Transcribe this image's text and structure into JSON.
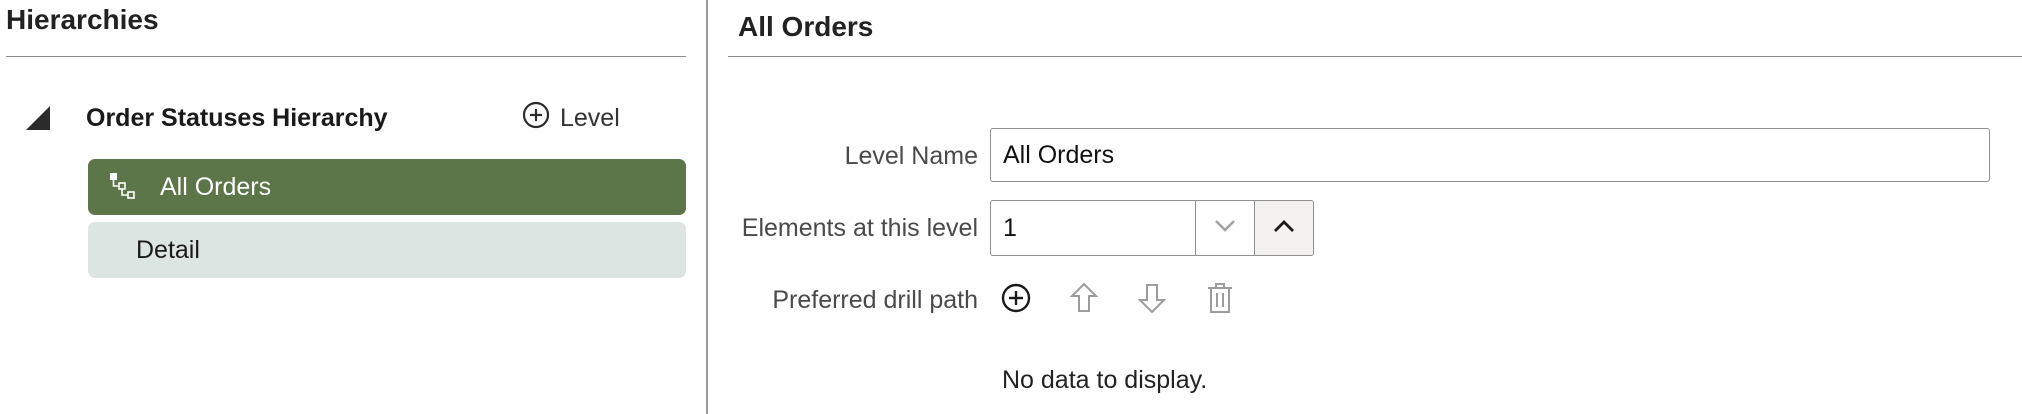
{
  "left_panel": {
    "title": "Hierarchies",
    "hierarchy_label": "Order Statuses Hierarchy",
    "add_level_label": "Level",
    "levels": [
      {
        "label": "All Orders",
        "selected": true,
        "icon": "hierarchy-levels-icon"
      },
      {
        "label": "Detail",
        "selected": false
      }
    ]
  },
  "right_panel": {
    "title": "All Orders",
    "level_name_label": "Level Name",
    "level_name_value": "All Orders",
    "elements_label": "Elements at this level",
    "elements_value": "1",
    "drill_path_label": "Preferred drill path",
    "drill_tools": [
      "add-circle-icon",
      "arrow-up-icon",
      "arrow-down-icon",
      "trash-icon"
    ],
    "empty_message": "No data to display."
  },
  "colors": {
    "selected_bg": "#5c7549",
    "unselected_bg": "#dde5e3",
    "divider": "#9a9a9a"
  }
}
